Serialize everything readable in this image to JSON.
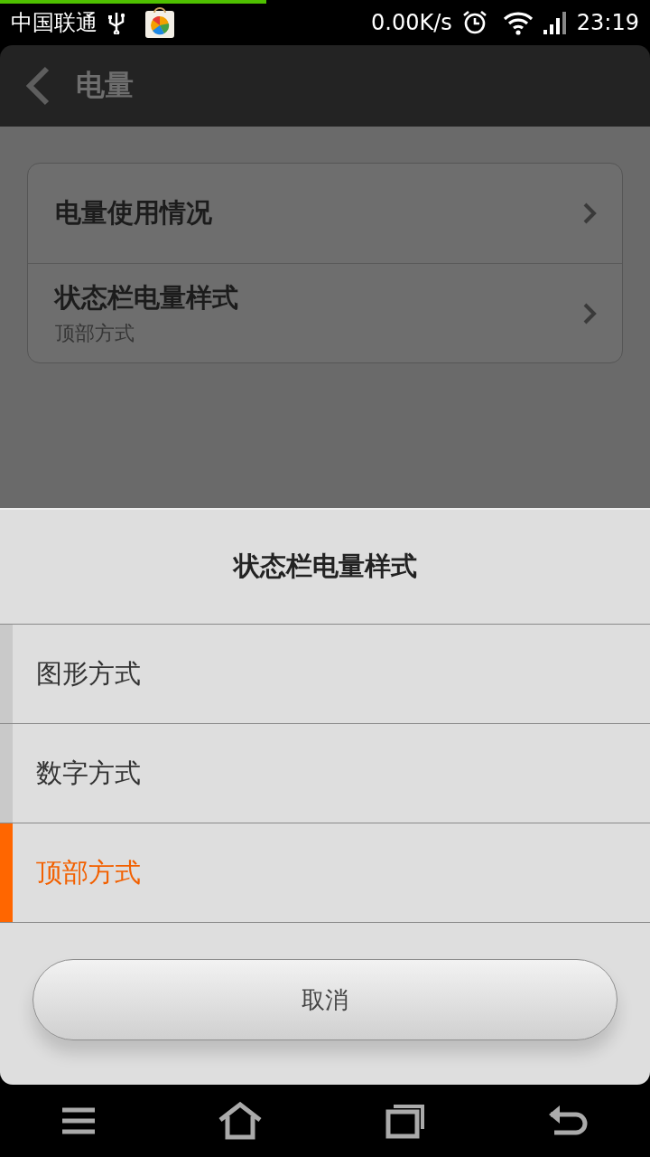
{
  "status_bar": {
    "carrier": "中国联通",
    "speed": "0.00K/s",
    "time": "23:19",
    "progress": {
      "level": 0.41
    }
  },
  "header": {
    "title": "电量"
  },
  "settings": [
    {
      "title": "电量使用情况"
    },
    {
      "title": "状态栏电量样式",
      "subtitle": "顶部方式"
    }
  ],
  "dialog": {
    "title": "状态栏电量样式",
    "options": [
      {
        "label": "图形方式",
        "selected": false
      },
      {
        "label": "数字方式",
        "selected": false
      },
      {
        "label": "顶部方式",
        "selected": true
      }
    ],
    "cancel": "取消"
  }
}
